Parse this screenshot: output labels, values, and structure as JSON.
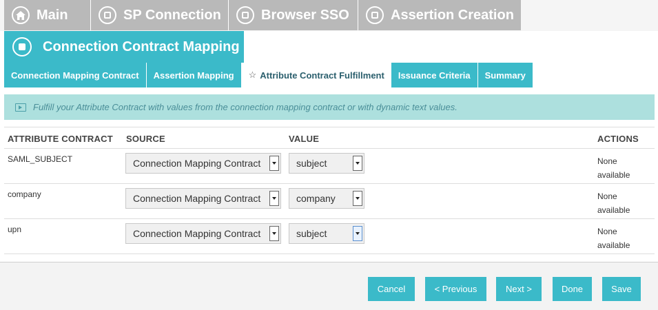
{
  "breadcrumbs": [
    {
      "label": "Main",
      "icon": "home-icon"
    },
    {
      "label": "SP Connection",
      "icon": "step-icon"
    },
    {
      "label": "Browser SSO",
      "icon": "step-icon"
    },
    {
      "label": "Assertion Creation",
      "icon": "step-icon"
    }
  ],
  "current_step": {
    "label": "Connection Contract Mapping",
    "icon": "step-current-icon"
  },
  "tabs": [
    {
      "label": "Connection Mapping Contract"
    },
    {
      "label": "Assertion Mapping"
    },
    {
      "label": "Attribute Contract Fulfillment",
      "active": true
    },
    {
      "label": "Issuance Criteria"
    },
    {
      "label": "Summary"
    }
  ],
  "banner": {
    "text": "Fulfill your Attribute Contract with values from the connection mapping contract or with dynamic text values."
  },
  "table": {
    "headers": {
      "attribute": "ATTRIBUTE CONTRACT",
      "source": "SOURCE",
      "value": "VALUE",
      "actions": "ACTIONS"
    },
    "rows": [
      {
        "attribute": "SAML_SUBJECT",
        "source": "Connection Mapping Contract",
        "value": "subject",
        "actions_line1": "None",
        "actions_line2": "available"
      },
      {
        "attribute": "company",
        "source": "Connection Mapping Contract",
        "value": "company",
        "actions_line1": "None",
        "actions_line2": "available"
      },
      {
        "attribute": "upn",
        "source": "Connection Mapping Contract",
        "value": "subject",
        "actions_line1": "None",
        "actions_line2": "available"
      }
    ]
  },
  "buttons": {
    "cancel": "Cancel",
    "previous": "< Previous",
    "next": "Next >",
    "done": "Done",
    "save": "Save"
  },
  "colors": {
    "accent": "#3bbac9",
    "breadcrumb_inactive": "#b9b9b9",
    "banner_bg": "#ade0de"
  }
}
